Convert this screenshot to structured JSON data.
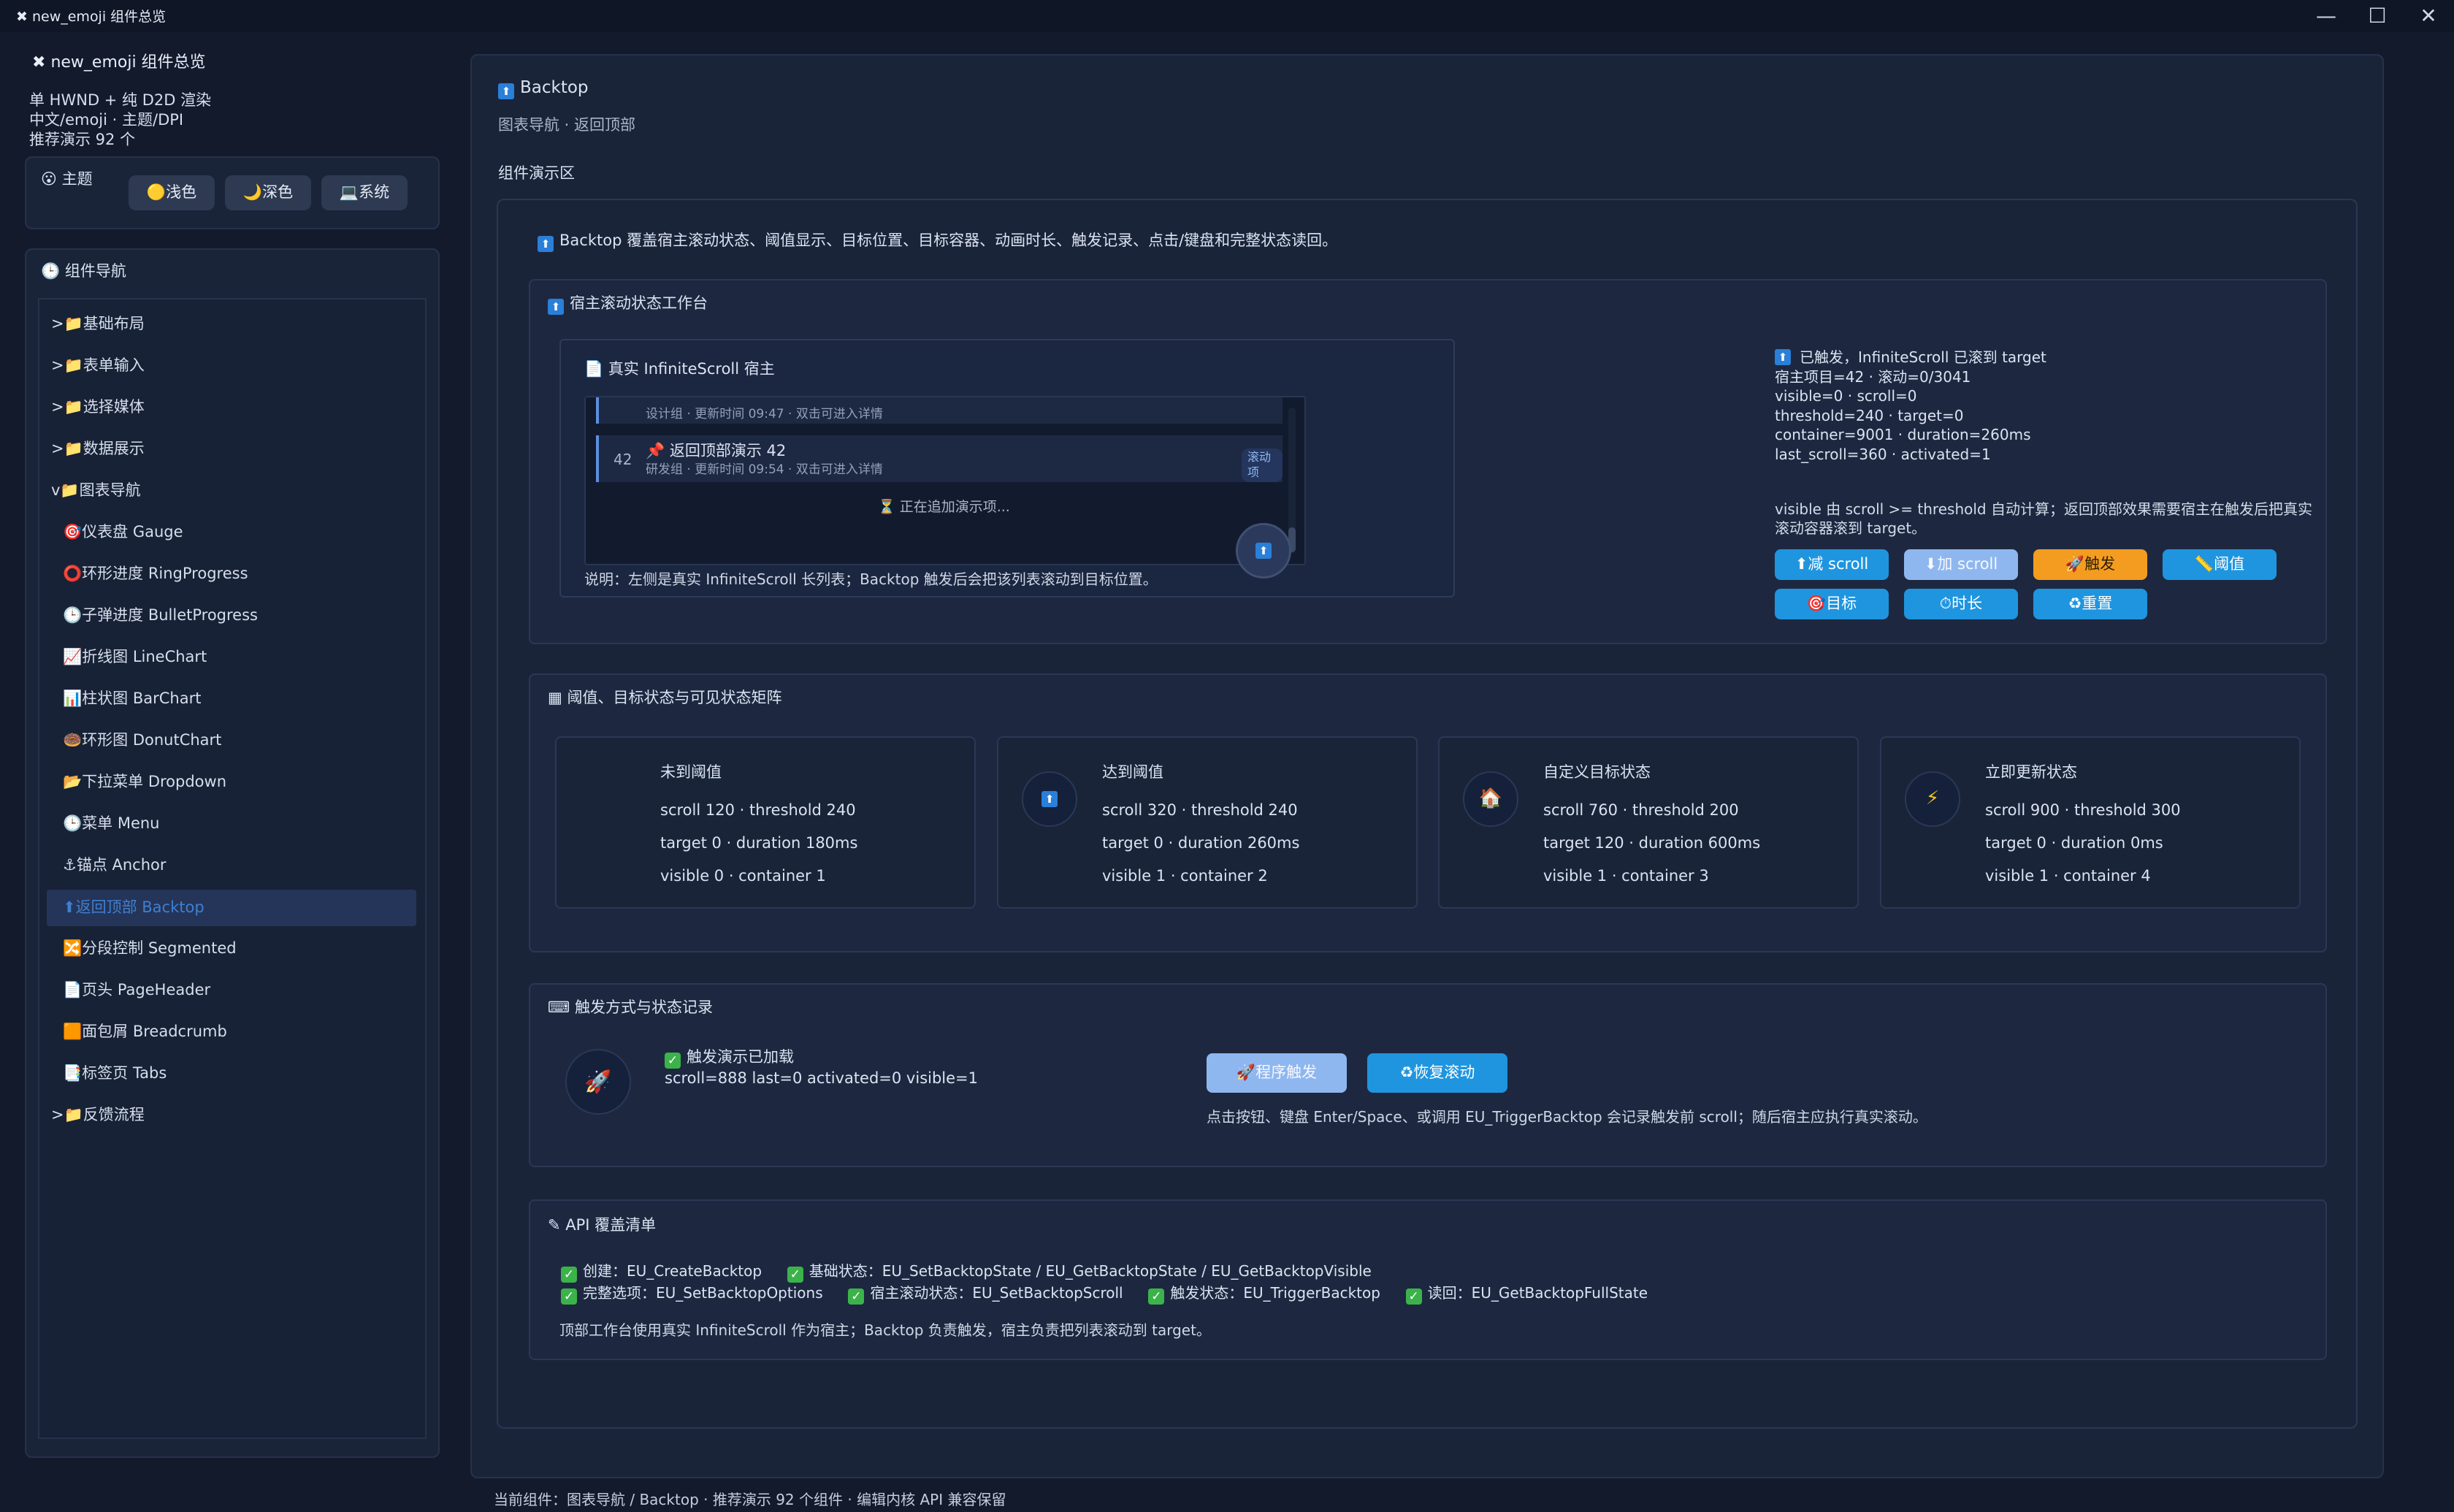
{
  "window": {
    "title": "new_emoji 组件总览",
    "minimize": "—",
    "maximize": "☐",
    "close": "✕"
  },
  "sidebar": {
    "app_title": "new_emoji 组件总览",
    "info_lines": [
      "单 HWND + 纯 D2D 渲染",
      "中文/emoji · 主题/DPI",
      "推荐演示 92 个"
    ],
    "theme": {
      "label": "主题",
      "options": [
        "🟡浅色",
        "🌙深色",
        "💻系统"
      ]
    },
    "nav_title": "组件导航",
    "nav_items": [
      {
        "label": ">📁基础布局"
      },
      {
        "label": ">📁表单输入"
      },
      {
        "label": ">📁选择媒体"
      },
      {
        "label": ">📁数据展示"
      },
      {
        "label": "v📁图表导航"
      },
      {
        "label": "🎯仪表盘 Gauge"
      },
      {
        "label": "⭕环形进度 RingProgress"
      },
      {
        "label": "🕒子弹进度 BulletProgress"
      },
      {
        "label": "📈折线图 LineChart"
      },
      {
        "label": "📊柱状图 BarChart"
      },
      {
        "label": "🍩环形图 DonutChart"
      },
      {
        "label": "📂下拉菜单 Dropdown"
      },
      {
        "label": "🕒菜单 Menu"
      },
      {
        "label": "⚓锚点 Anchor"
      },
      {
        "label": "⬆返回顶部 Backtop"
      },
      {
        "label": "🔀分段控制 Segmented"
      },
      {
        "label": "📄页头 PageHeader"
      },
      {
        "label": "🟧面包屑 Breadcrumb"
      },
      {
        "label": "📑标签页 Tabs"
      },
      {
        "label": ">📁反馈流程"
      }
    ]
  },
  "main": {
    "page_title": "Backtop",
    "breadcrumb": "图表导航 · 返回顶部",
    "demo_area_label": "组件演示区",
    "intro": "Backtop 覆盖宿主滚动状态、阈值显示、目标位置、目标容器、动画时长、触发记录、点击/键盘和完整状态读回。",
    "workbench": {
      "title": "宿主滚动状态工作台",
      "host_title": "真实 InfiniteScroll 宿主",
      "list_row_prev_meta": "设计组 · 更新时间 09:47 · 双击可进入详情",
      "list_row_num": "42",
      "list_row_title": "📌 返回顶部演示 42",
      "list_row_meta": "研发组 · 更新时间 09:54 · 双击可进入详情",
      "list_row_tag": "滚动项",
      "loading": "⏳ 正在追加演示项...",
      "note": "说明：左侧是真实 InfiniteScroll 长列表；Backtop 触发后会把该列表滚动到目标位置。",
      "status_lines": "已触发，InfiniteScroll 已滚到 target\n宿主项目=42 · 滚动=0/3041\nvisible=0 · scroll=0\nthreshold=240 · target=0\ncontainer=9001 · duration=260ms\nlast_scroll=360 · activated=1",
      "explain": "visible 由 scroll >= threshold 自动计算；返回顶部效果需要宿主在触发后把真实滚动容器滚到 target。",
      "buttons": [
        "⬆减 scroll",
        "⬇加 scroll",
        "🚀触发",
        "📏阈值",
        "🎯目标",
        "⏱时长",
        "♻重置"
      ]
    },
    "matrix": {
      "title": "阈值、目标状态与可见状态矩阵",
      "cards": [
        {
          "title": "未到阈值",
          "l1": "scroll 120 · threshold 240",
          "l2": "target 0 · duration 180ms",
          "l3": "visible 0 · container 1",
          "icon": ""
        },
        {
          "title": "达到阈值",
          "l1": "scroll 320 · threshold 240",
          "l2": "target 0 · duration 260ms",
          "l3": "visible 1 · container 2",
          "icon": "⬆"
        },
        {
          "title": "自定义目标状态",
          "l1": "scroll 760 · threshold 200",
          "l2": "target 120 · duration 600ms",
          "l3": "visible 1 · container 3",
          "icon": "🏠"
        },
        {
          "title": "立即更新状态",
          "l1": "scroll 900 · threshold 300",
          "l2": "target 0 · duration 0ms",
          "l3": "visible 1 · container 4",
          "icon": "⚡"
        }
      ]
    },
    "trigger": {
      "title": "触发方式与状态记录",
      "status_title": "触发演示已加载",
      "status_line": "scroll=888 last=0 activated=0 visible=1",
      "btn_program": "🚀程序触发",
      "btn_restore": "♻恢复滚动",
      "hint": "点击按钮、键盘 Enter/Space、或调用 EU_TriggerBacktop 会记录触发前 scroll；随后宿主应执行真实滚动。"
    },
    "api": {
      "title": "API 覆盖清单",
      "row1": [
        "创建：EU_CreateBacktop",
        "基础状态：EU_SetBacktopState / EU_GetBacktopState / EU_GetBacktopVisible"
      ],
      "row2": [
        "完整选项：EU_SetBacktopOptions",
        "宿主滚动状态：EU_SetBacktopScroll",
        "触发状态：EU_TriggerBacktop",
        "读回：EU_GetBacktopFullState"
      ],
      "note": "顶部工作台使用真实 InfiniteScroll 作为宿主；Backtop 负责触发，宿主负责把列表滚动到 target。"
    }
  },
  "statusbar": "当前组件：图表导航 / Backtop · 推荐演示 92 个组件 · 编辑内核 API 兼容保留"
}
